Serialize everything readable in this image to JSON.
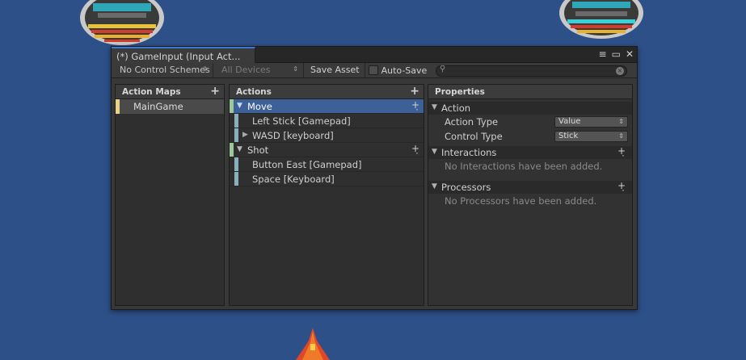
{
  "window": {
    "tab_title": "(*) GameInput (Input Act...",
    "controls": [
      "≡",
      "▭",
      "✕"
    ]
  },
  "toolbar": {
    "control_schemes": "No Control Schemes",
    "devices": "All Devices",
    "save_asset": "Save Asset",
    "auto_save": "Auto-Save",
    "auto_save_checked": false,
    "search_value": ""
  },
  "action_maps": {
    "header": "Action Maps",
    "items": [
      {
        "label": "MainGame",
        "selected": true
      }
    ]
  },
  "actions": {
    "header": "Actions",
    "items": [
      {
        "label": "Move",
        "selected": true,
        "bindings": [
          {
            "label": "Left Stick [Gamepad]",
            "expandable": false
          },
          {
            "label": "WASD [keyboard]",
            "expandable": true
          }
        ]
      },
      {
        "label": "Shot",
        "selected": false,
        "bindings": [
          {
            "label": "Button East [Gamepad]",
            "expandable": false
          },
          {
            "label": "Space [Keyboard]",
            "expandable": false
          }
        ]
      }
    ]
  },
  "properties": {
    "header": "Properties",
    "action_section": "Action",
    "action_type_label": "Action Type",
    "action_type_value": "Value",
    "control_type_label": "Control Type",
    "control_type_value": "Stick",
    "interactions_section": "Interactions",
    "interactions_empty": "No Interactions have been added.",
    "processors_section": "Processors",
    "processors_empty": "No Processors have been added."
  },
  "colors": {
    "background": "#2d5088",
    "selection": "#3d6098",
    "map_bar": "#e8d389",
    "action_bar": "#9bc79a",
    "binding_bar": "#8ab0bd"
  }
}
